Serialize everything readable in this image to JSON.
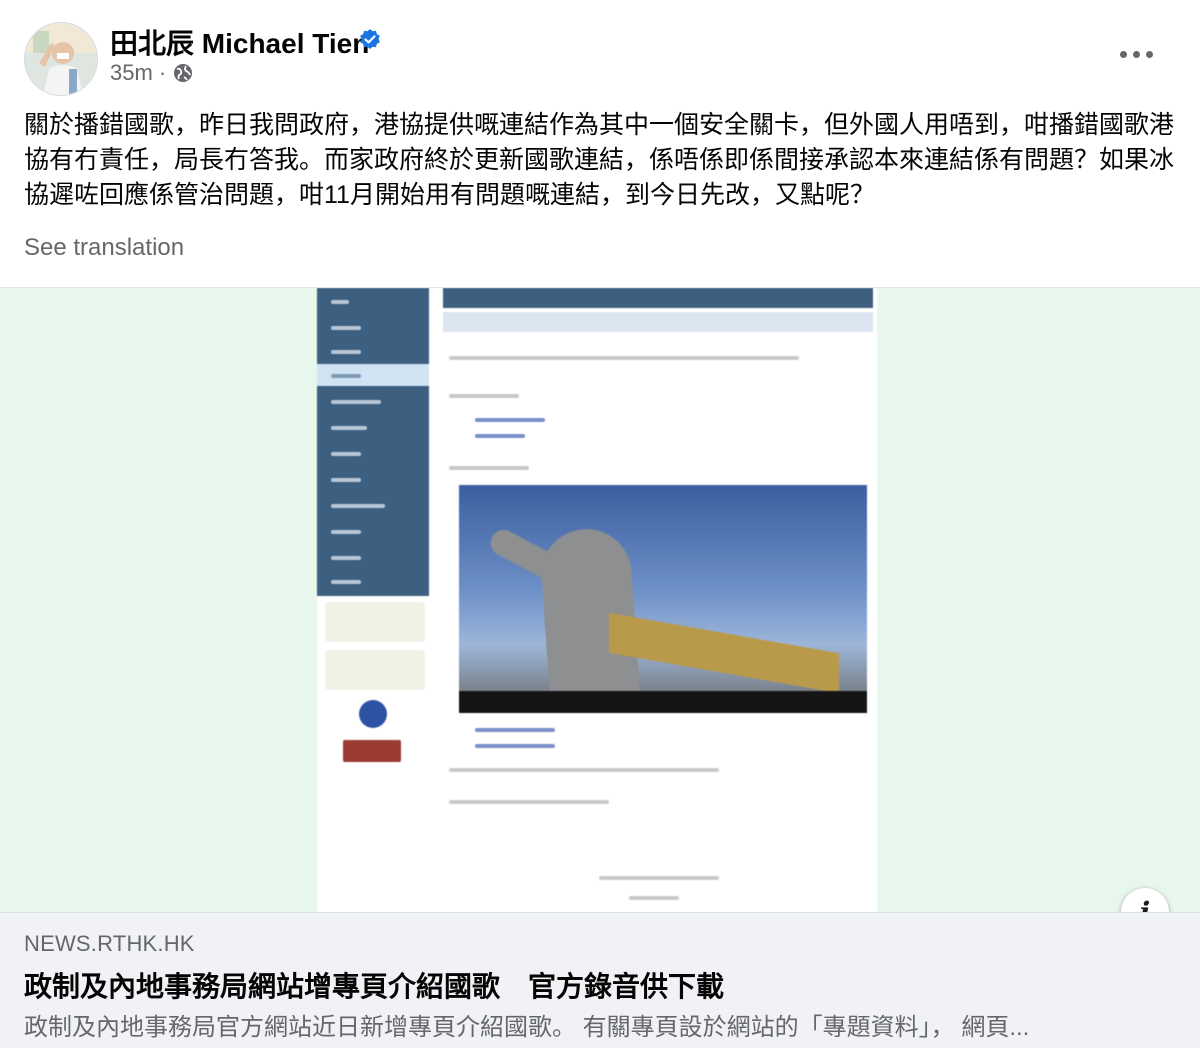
{
  "post": {
    "author": {
      "name": "田北辰 Michael Tien",
      "verified": true,
      "avatar_icon": "profile-photo"
    },
    "meta": {
      "time": "35m ·",
      "audience_icon": "globe-icon"
    },
    "more_icon": "more-options-icon",
    "text": "關於播錯國歌，昨日我問政府，港協提供嘅連結作為其中一個安全關卡，但外國人用唔到，咁播錯國歌港協有冇責任，局長冇答我。而家政府終於更新國歌連結，係唔係即係間接承認本來連結係有問題？如果冰協遲咗回應係管治問題，咁11月開始用有問題嘅連結，到今日先改，又點呢？",
    "see_translation": "See translation"
  },
  "link_preview": {
    "info_icon": "info-icon",
    "domain": "NEWS.RTHK.HK",
    "title": "政制及內地事務局網站增專頁介紹國歌　官方錄音供下載",
    "description": "政制及內地事務局官方網站近日新增專頁介紹國歌。 有關專頁設於網站的「專題資料」， 網頁..."
  },
  "colors": {
    "verified_badge": "#1b74e4",
    "media_background": "#e7f7ec",
    "card_background": "#f0f2f5",
    "secondary_text": "#65676b"
  }
}
